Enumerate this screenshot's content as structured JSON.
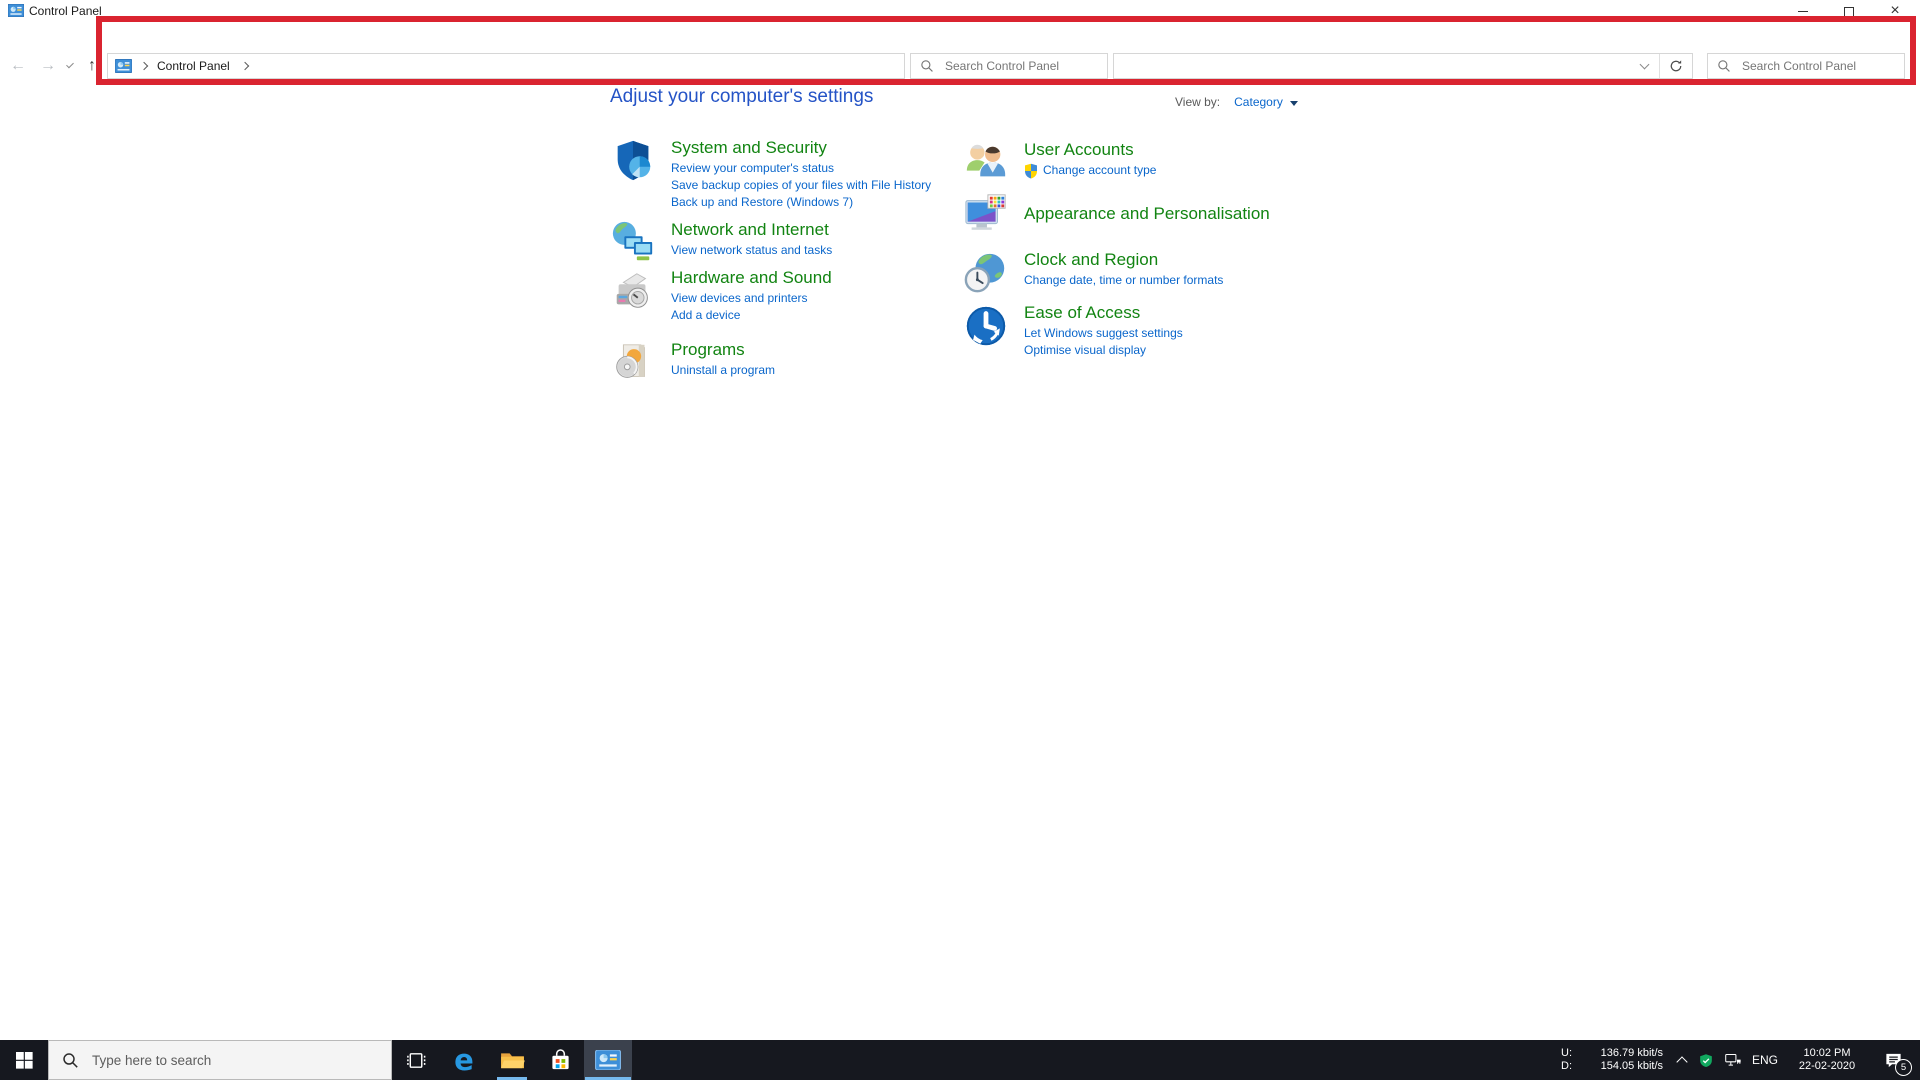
{
  "window": {
    "title": "Control Panel"
  },
  "navbar": {
    "breadcrumb": {
      "location": "Control Panel"
    },
    "search_left": {
      "placeholder": "Search Control Panel"
    },
    "address_bar": {
      "value": ""
    },
    "search_right": {
      "placeholder": "Search Control Panel"
    }
  },
  "annotation": {
    "shape": "rectangle",
    "color": "#da2430"
  },
  "content": {
    "heading": "Adjust your computer's settings",
    "view_by": {
      "label": "View by:",
      "value": "Category"
    },
    "categories": {
      "left": [
        {
          "title": "System and Security",
          "links": [
            "Review your computer's status",
            "Save backup copies of your files with File History",
            "Back up and Restore (Windows 7)"
          ]
        },
        {
          "title": "Network and Internet",
          "links": [
            "View network status and tasks"
          ]
        },
        {
          "title": "Hardware and Sound",
          "links": [
            "View devices and printers",
            "Add a device"
          ]
        },
        {
          "title": "Programs",
          "links": [
            "Uninstall a program"
          ]
        }
      ],
      "right": [
        {
          "title": "User Accounts",
          "links": [
            "Change account type"
          ]
        },
        {
          "title": "Appearance and Personalisation",
          "links": []
        },
        {
          "title": "Clock and Region",
          "links": [
            "Change date, time or number formats"
          ]
        },
        {
          "title": "Ease of Access",
          "links": [
            "Let Windows suggest settings",
            "Optimise visual display"
          ]
        }
      ]
    }
  },
  "taskbar": {
    "search": {
      "placeholder": "Type here to search"
    },
    "tray": {
      "upload_label": "U:",
      "upload_value": "136.79 kbit/s",
      "download_label": "D:",
      "download_value": "154.05 kbit/s",
      "language": "ENG",
      "time": "10:02 PM",
      "date": "22-02-2020",
      "notification_count": "5"
    }
  },
  "colors": {
    "annotation_red": "#da2430",
    "category_green": "#128412",
    "link_blue": "#0a66cb",
    "heading_blue": "#2453c6",
    "taskbar_bg": "#16181f",
    "active_underline": "#76b9ed"
  }
}
